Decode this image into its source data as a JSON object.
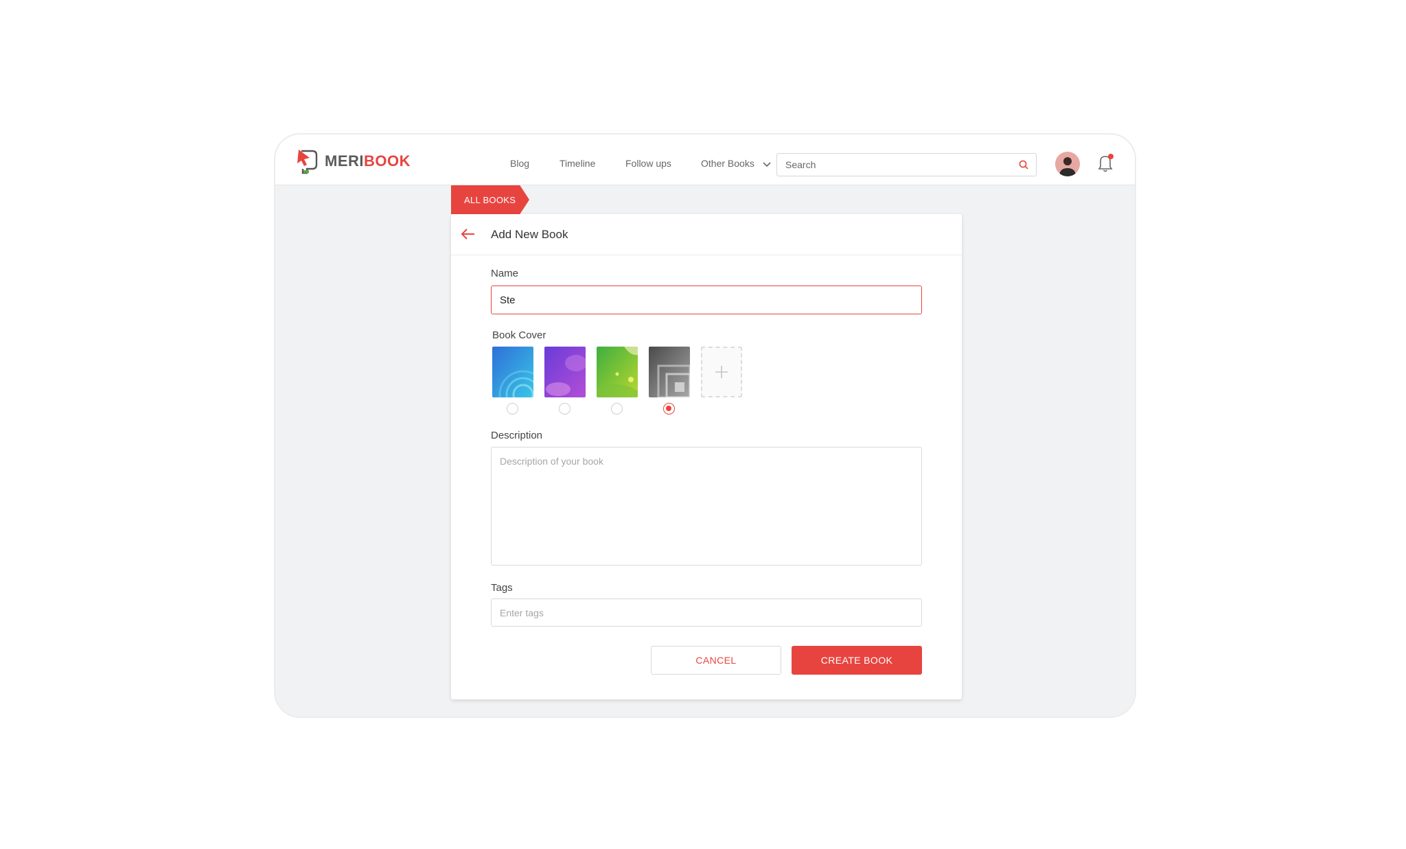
{
  "brand": {
    "name_part1": "MERI",
    "name_part2": "BOOK"
  },
  "nav": {
    "items": [
      {
        "label": "Blog"
      },
      {
        "label": "Timeline"
      },
      {
        "label": "Follow ups"
      },
      {
        "label": "Other Books"
      }
    ]
  },
  "search": {
    "placeholder": "Search",
    "value": ""
  },
  "breadcrumb": {
    "label": "ALL BOOKS"
  },
  "form": {
    "title": "Add New Book",
    "name_label": "Name",
    "name_value": "Ste",
    "cover_label": "Book Cover",
    "covers": [
      {
        "style": "blue",
        "selected": false
      },
      {
        "style": "purple",
        "selected": false
      },
      {
        "style": "green",
        "selected": false
      },
      {
        "style": "gray",
        "selected": true
      }
    ],
    "description_label": "Description",
    "description_placeholder": "Description of your book",
    "description_value": "",
    "tags_label": "Tags",
    "tags_placeholder": "Enter tags",
    "tags_value": "",
    "cancel_label": "CANCEL",
    "create_label": "CREATE BOOK"
  },
  "colors": {
    "accent": "#e8443f",
    "background": "#f1f2f3"
  },
  "icons": [
    "logo-icon",
    "chevron-down-icon",
    "search-icon",
    "avatar",
    "bell-icon",
    "back-arrow-icon",
    "plus-icon"
  ]
}
